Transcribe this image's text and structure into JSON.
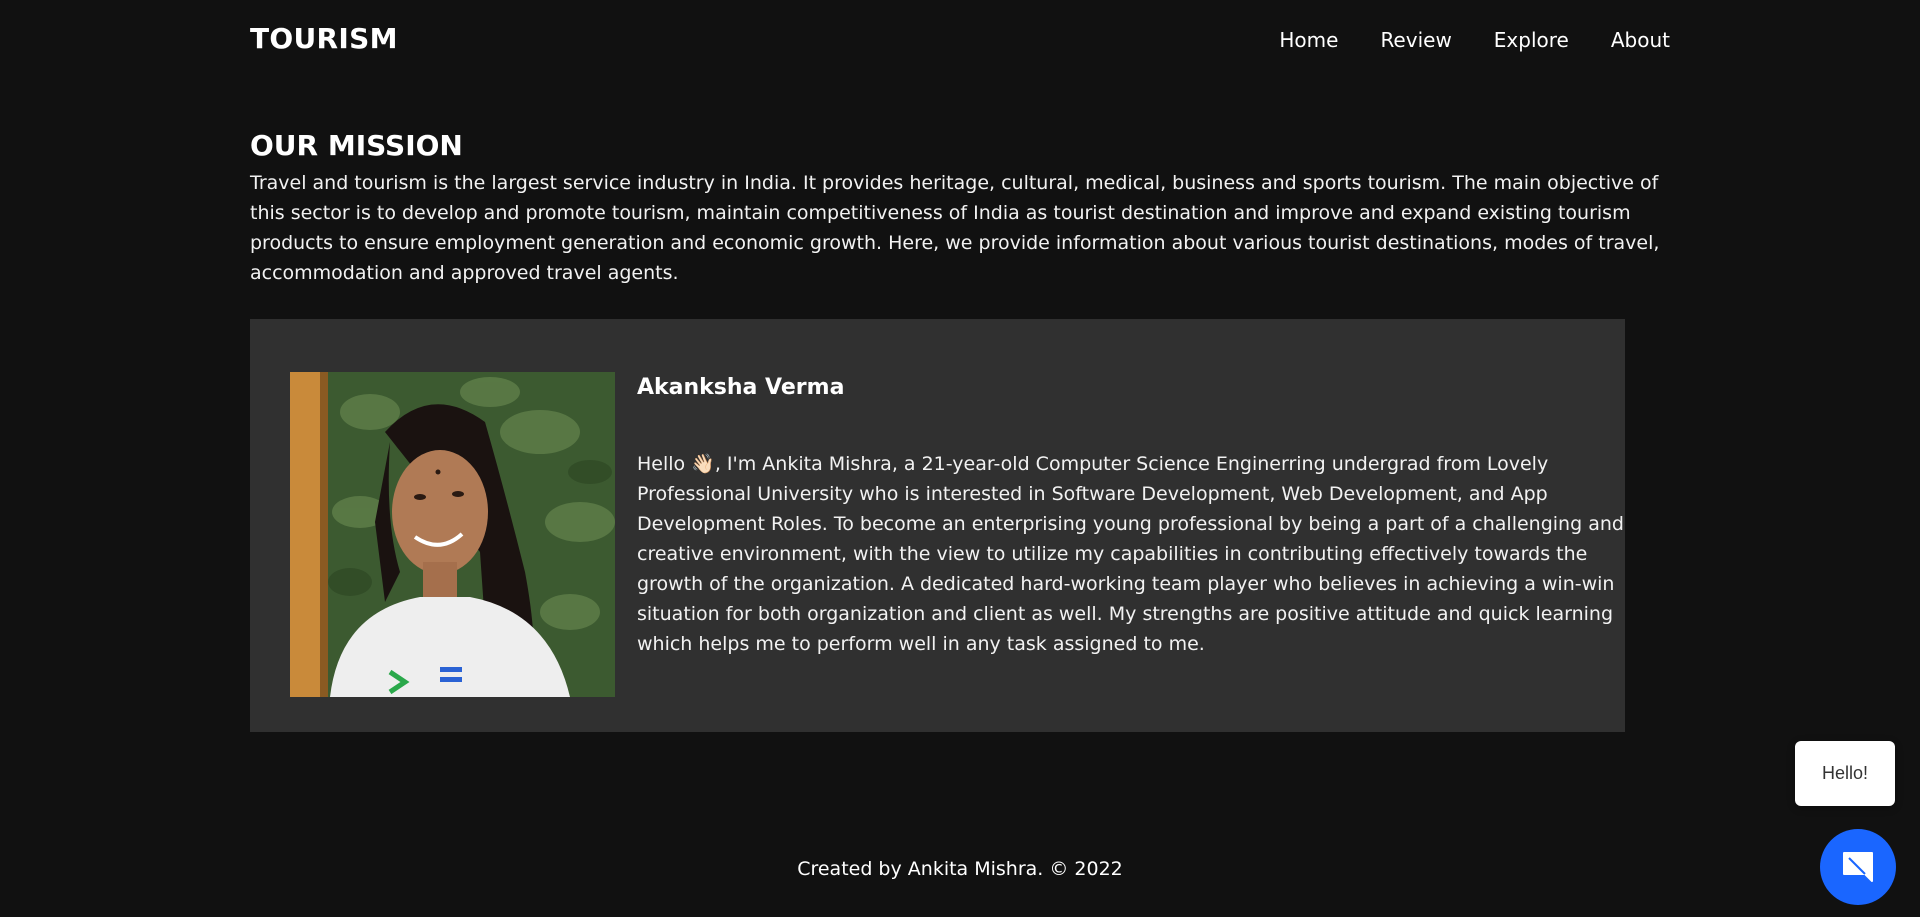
{
  "header": {
    "brand": "TOURISM",
    "nav": [
      "Home",
      "Review",
      "Explore",
      "About"
    ]
  },
  "mission": {
    "title": "OUR MISSION",
    "text": "Travel and tourism is the largest service industry in India. It provides heritage, cultural, medical, business and sports tourism. The main objective of this sector is to develop and promote tourism, maintain competitiveness of India as tourist destination and improve and expand existing tourism products to ensure employment generation and economic growth. Here, we provide information about various tourist destinations, modes of travel, accommodation and approved travel agents."
  },
  "profile": {
    "name": "Akanksha Verma",
    "bio": "Hello 👋🏻, I'm Ankita Mishra, a 21-year-old Computer Science Enginerring undergrad from Lovely Professional University who is interested in Software Development, Web Development, and App Development Roles. To become an enterprising young professional by being a part of a challenging and creative environment, with the view to utilize my capabilities in contributing effectively towards the growth of the organization. A dedicated hard-working team player who believes in achieving a win-win situation for both organization and client as well. My strengths are positive attitude and quick learning which helps me to perform well in any task assigned to me."
  },
  "footer": {
    "text": "Created by Ankita Mishra. © 2022"
  },
  "chat": {
    "greeting": "Hello!",
    "button_icon": "chat-icon"
  },
  "colors": {
    "background": "#111111",
    "card": "#303030",
    "chat_accent": "#1a66ff"
  }
}
